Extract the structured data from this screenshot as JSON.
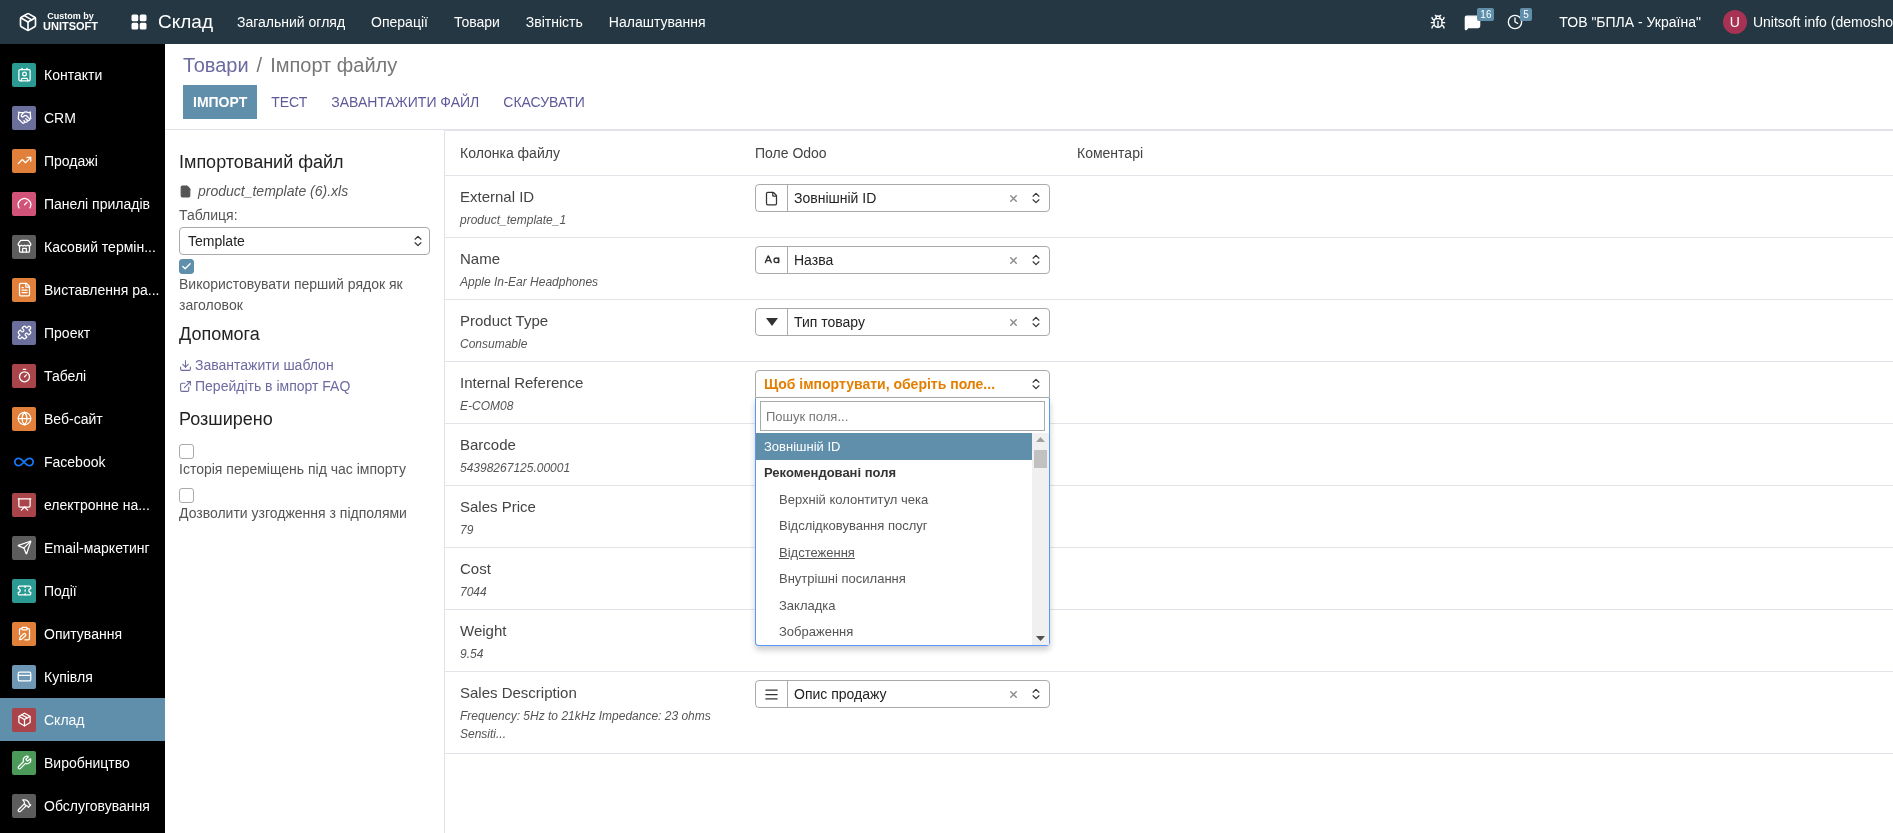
{
  "topbar": {
    "brand_top": "Custom by",
    "brand_bottom": "UNITSOFT",
    "app": "Склад",
    "menu": [
      "Загальний огляд",
      "Операції",
      "Товари",
      "Звітність",
      "Налаштування"
    ],
    "messages_count": "16",
    "activities_count": "5",
    "company": "ТОВ \"БПЛА - Україна\"",
    "avatar": "U",
    "user": "Unitsoft info (demosho"
  },
  "sidebar": {
    "items": [
      {
        "label": "Контакти",
        "kind": "tile",
        "color": "#2b9a93",
        "selected": false
      },
      {
        "label": "CRM",
        "kind": "tile",
        "color": "#6b6f9c",
        "selected": false
      },
      {
        "label": "Продажі",
        "kind": "tile",
        "color": "#e0803a",
        "selected": false
      },
      {
        "label": "Панелі приладів",
        "kind": "tile",
        "color": "#d2537a",
        "selected": false
      },
      {
        "label": "Касовий термін...",
        "kind": "tile",
        "color": "#5c5c5c",
        "selected": false
      },
      {
        "label": "Виставлення ра...",
        "kind": "tile",
        "color": "#e0803a",
        "selected": false
      },
      {
        "label": "Проект",
        "kind": "tile",
        "color": "#6b6f9c",
        "selected": false
      },
      {
        "label": "Табелі",
        "kind": "tile",
        "color": "#a9454a",
        "selected": false
      },
      {
        "label": "Веб-сайт",
        "kind": "tile",
        "color": "#e0803a",
        "selected": false
      },
      {
        "label": "Facebook",
        "kind": "logo",
        "color": "#1877f2",
        "selected": false
      },
      {
        "label": "електронне на...",
        "kind": "tile",
        "color": "#a9454a",
        "selected": false
      },
      {
        "label": "Email-маркетинг",
        "kind": "tile",
        "color": "#5c5c5c",
        "selected": false
      },
      {
        "label": "Події",
        "kind": "tile",
        "color": "#2b9a93",
        "selected": false
      },
      {
        "label": "Опитування",
        "kind": "tile",
        "color": "#e0803a",
        "selected": false
      },
      {
        "label": "Купівля",
        "kind": "tile",
        "color": "#6e97b5",
        "selected": false
      },
      {
        "label": "Склад",
        "kind": "tile",
        "color": "#a9454a",
        "selected": true
      },
      {
        "label": "Виробництво",
        "kind": "tile",
        "color": "#4c9a5a",
        "selected": false
      },
      {
        "label": "Обслуговування",
        "kind": "tile",
        "color": "#5c5c5c",
        "selected": false
      }
    ]
  },
  "breadcrumb": {
    "parent": "Товари",
    "separator": "/",
    "current": "Імпорт файлу"
  },
  "actions": [
    {
      "label": "ІМПОРТ",
      "kind": "primary"
    },
    {
      "label": "ТЕСТ",
      "kind": "link"
    },
    {
      "label": "ЗАВАНТАЖИТИ ФАЙЛ",
      "kind": "link"
    },
    {
      "label": "СКАСУВАТИ",
      "kind": "link"
    }
  ],
  "import_panel": {
    "title": "Імпортований файл",
    "file": "product_template (6).xls",
    "sheet_label": "Таблиця:",
    "sheet_value": "Template",
    "header_option": {
      "label": "Використовувати перший рядок як заголовок",
      "checked": true
    },
    "help_title": "Допомога",
    "help_links": [
      "Завантажити шаблон",
      "Перейдіть в імпорт FAQ"
    ],
    "advanced_title": "Розширено",
    "advanced_options": [
      {
        "label": "Історія переміщень під час імпорту",
        "checked": false
      },
      {
        "label": "Дозволити узгодження з підполями",
        "checked": false
      }
    ]
  },
  "table": {
    "columns": [
      "Колонка файлу",
      "Поле Odoo",
      "Коментарі"
    ],
    "rows": [
      {
        "column": "External ID",
        "sample": "product_template_1",
        "mapping": {
          "kind": "id",
          "value": "Зовнішній ID"
        }
      },
      {
        "column": "Name",
        "sample": "Apple In-Ear Headphones",
        "mapping": {
          "kind": "char",
          "value": "Назва"
        }
      },
      {
        "column": "Product Type",
        "sample": "Consumable",
        "mapping": {
          "kind": "selection",
          "value": "Тип товару"
        }
      },
      {
        "column": "Internal Reference",
        "sample": "E-COM08",
        "mapping": {
          "kind": "unset",
          "placeholder": "Щоб імпортувати, оберіть поле..."
        }
      },
      {
        "column": "Barcode",
        "sample": "54398267125.00001"
      },
      {
        "column": "Sales Price",
        "sample": "79"
      },
      {
        "column": "Cost",
        "sample": "7044"
      },
      {
        "column": "Weight",
        "sample": "9.54"
      },
      {
        "column": "Sales Description",
        "sample": "Frequency: 5Hz to 21kHz Impedance: 23 ohms Sensiti...",
        "mapping": {
          "kind": "text",
          "value": "Опис продажу"
        }
      }
    ]
  },
  "dropdown": {
    "search_placeholder": "Пошук поля...",
    "options": [
      {
        "label": "Зовнішній ID",
        "kind": "option",
        "selected": true
      },
      {
        "label": "Рекомендовані поля",
        "kind": "group",
        "children": [
          {
            "label": "Верхній колонтитул чека",
            "kind": "option",
            "selected": false
          },
          {
            "label": "Відслідковування послуг",
            "kind": "option",
            "selected": false
          },
          {
            "label": "Відстеження",
            "kind": "expandable",
            "selected": false
          },
          {
            "label": "Внутрішні посилання",
            "kind": "option",
            "selected": false
          },
          {
            "label": "Закладка",
            "kind": "option",
            "selected": false
          },
          {
            "label": "Зображення",
            "kind": "option",
            "selected": false
          }
        ]
      }
    ]
  }
}
